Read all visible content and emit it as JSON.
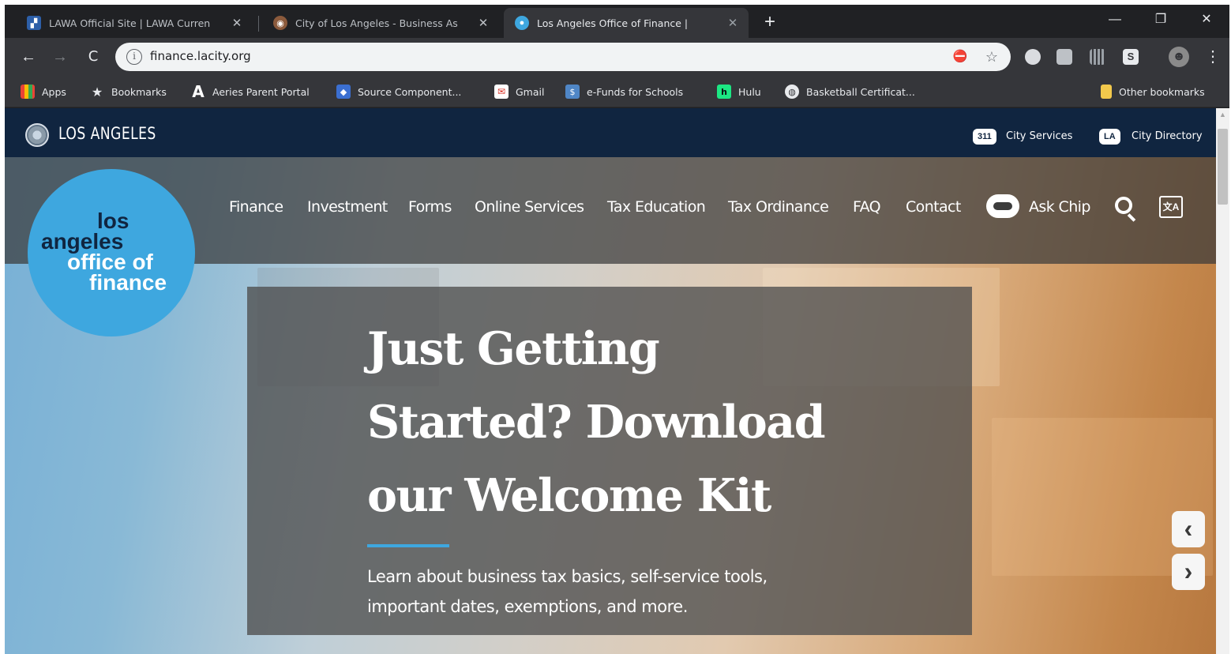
{
  "browser": {
    "tabs": [
      {
        "title": "LAWA Official Site | LAWA Curren",
        "close": "✕"
      },
      {
        "title": "City of Los Angeles - Business As",
        "close": "✕"
      },
      {
        "title": "Los Angeles Office of Finance |",
        "close": "✕"
      }
    ],
    "new_tab": "+",
    "window_controls": {
      "minimize": "—",
      "restore": "❐",
      "close": "✕"
    },
    "back": "←",
    "forward": "→",
    "reload": "C",
    "info": "i",
    "url": "finance.lacity.org",
    "omnibox_icons": {
      "blocked": "⛔",
      "star": "☆"
    },
    "menu": "⋮",
    "profile": "☻"
  },
  "bookmarks": [
    {
      "label": "Apps",
      "icon": "apps-grid-icon"
    },
    {
      "label": "Bookmarks",
      "icon": "star-icon"
    },
    {
      "label": "Aeries Parent Portal",
      "icon": "aeries-icon"
    },
    {
      "label": "Source Component...",
      "icon": "source-icon"
    },
    {
      "label": "Gmail",
      "icon": "gmail-icon"
    },
    {
      "label": "e-Funds for Schools",
      "icon": "efunds-icon"
    },
    {
      "label": "Hulu",
      "icon": "hulu-icon"
    },
    {
      "label": "Basketball Certificat...",
      "icon": "globe-icon"
    },
    {
      "label": "Other bookmarks",
      "icon": "folder-icon"
    }
  ],
  "citybar": {
    "title": "LOS ANGELES",
    "services_badge": "311",
    "services_label": "City Services",
    "directory_badge": "LA",
    "directory_label": "City Directory"
  },
  "logo": {
    "lines": [
      "los",
      "angeles",
      "office of",
      "finance"
    ]
  },
  "nav": {
    "items": [
      "Finance",
      "Investment",
      "Forms",
      "Online Services",
      "Tax Education",
      "Tax Ordinance",
      "FAQ",
      "Contact"
    ],
    "ask_chip": "Ask Chip",
    "translate": "文A"
  },
  "hero": {
    "headline_lines": [
      "Just Getting",
      "Started? Download",
      "our Welcome Kit"
    ],
    "subtext_lines": [
      "Learn about business tax basics, self-service tools,",
      "important dates, exemptions, and more."
    ],
    "prev": "‹",
    "next": "›"
  },
  "colors": {
    "city_bar": "#102540",
    "brand_blue": "#3ea7df",
    "logo_text_dark": "#102540"
  }
}
